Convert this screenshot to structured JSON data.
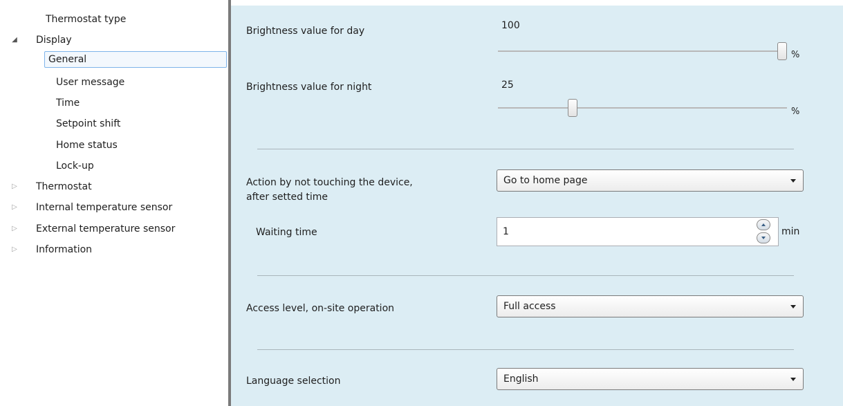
{
  "sidebar": {
    "items": [
      {
        "label": "Thermostat type",
        "expander": ""
      },
      {
        "label": "Display",
        "expander": "expanded"
      },
      {
        "label": "General",
        "expander": ""
      },
      {
        "label": "User message",
        "expander": ""
      },
      {
        "label": "Time",
        "expander": ""
      },
      {
        "label": "Setpoint shift",
        "expander": ""
      },
      {
        "label": "Home status",
        "expander": ""
      },
      {
        "label": "Lock-up",
        "expander": ""
      },
      {
        "label": "Thermostat",
        "expander": "collapsed"
      },
      {
        "label": "Internal temperature sensor",
        "expander": "collapsed"
      },
      {
        "label": "External temperature sensor",
        "expander": "collapsed"
      },
      {
        "label": "Information",
        "expander": "collapsed"
      }
    ],
    "selected": "General",
    "expander_glyphs": {
      "expanded": "◢",
      "collapsed": "▷"
    }
  },
  "params": {
    "brightness_day": {
      "label": "Brightness value for day",
      "value": "100",
      "unit": "%",
      "level_fraction": 1.0
    },
    "brightness_night": {
      "label": "Brightness value for night",
      "value": "25",
      "unit": "%",
      "level_fraction": 0.25
    },
    "action_untouched": {
      "label_line1": "Action by not touching the device,",
      "label_line2": "after setted time",
      "value": "Go to home page"
    },
    "waiting_time": {
      "label": "Waiting time",
      "value": "1",
      "unit": "min"
    },
    "access_level": {
      "label": "Access level, on-site operation",
      "value": "Full access"
    },
    "language": {
      "label": "Language selection",
      "value": "English"
    }
  },
  "colors": {
    "panel_background": "#dcedf4",
    "selection_border": "#7eb4ea",
    "splitter": "#7a7a7a"
  },
  "icons": {
    "dropdown": "chevron-down-icon",
    "spin_up": "spin-up-icon",
    "spin_down": "spin-down-icon"
  }
}
